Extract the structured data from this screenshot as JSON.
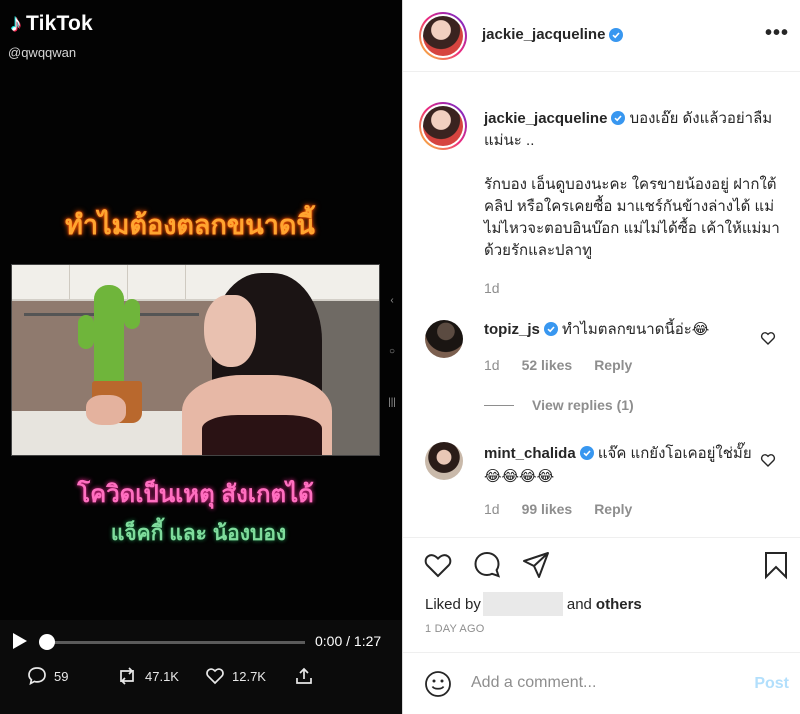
{
  "tiktok": {
    "brand": "TikTok",
    "handle": "@qwqqwan",
    "caption_top": "ทำไมต้องตลกขนาดนี้",
    "caption_middle": "โควิดเป็นเหตุ สังเกตได้",
    "caption_bottom": "แจ็คกี้ และ น้องบอง",
    "player": {
      "time": "0:00 / 1:27",
      "progress": 0
    },
    "stats": {
      "comments": "59",
      "reposts": "47.1K",
      "likes": "12.7K"
    }
  },
  "instagram": {
    "header": {
      "username": "jackie_jacqueline"
    },
    "caption": {
      "username": "jackie_jacqueline",
      "line1": "บองเอ๊ย ดังแล้วอย่าลืมแม่นะ ..",
      "line2": "รักบอง เอ็นดูบองนะคะ ใครขายน้องอยู่ ฝากใต้คลิป หรือใครเคยซื้อ มาแชร์กันข้างล่างได้ แม่ไม่ไหวจะตอบอินบ๊อก แม่ไม่ได้ซื้อ เค้าให้แม่มา ด้วยรักและปลาทู",
      "age": "1d"
    },
    "comments": [
      {
        "username": "topiz_js",
        "text": "ทำไมตลกขนาดนี้อ่ะ😂",
        "age": "1d",
        "likes": "52 likes",
        "reply": "Reply"
      },
      {
        "username": "mint_chalida",
        "text": "แจ๊ค แกยังโอเคอยู่ใช่มั๊ย😂😂😂😂",
        "age": "1d",
        "likes": "99 likes",
        "reply": "Reply"
      }
    ],
    "view_replies": "View replies (1)",
    "liked_by": {
      "prefix": "Liked by",
      "suffix": "and",
      "others": "others"
    },
    "date": "1 DAY AGO",
    "comment_box": {
      "placeholder": "Add a comment...",
      "post_label": "Post"
    },
    "colors": {
      "link_blue": "#0095f6",
      "post_disabled": "#b2dffc",
      "verified": "#3897f0"
    }
  }
}
